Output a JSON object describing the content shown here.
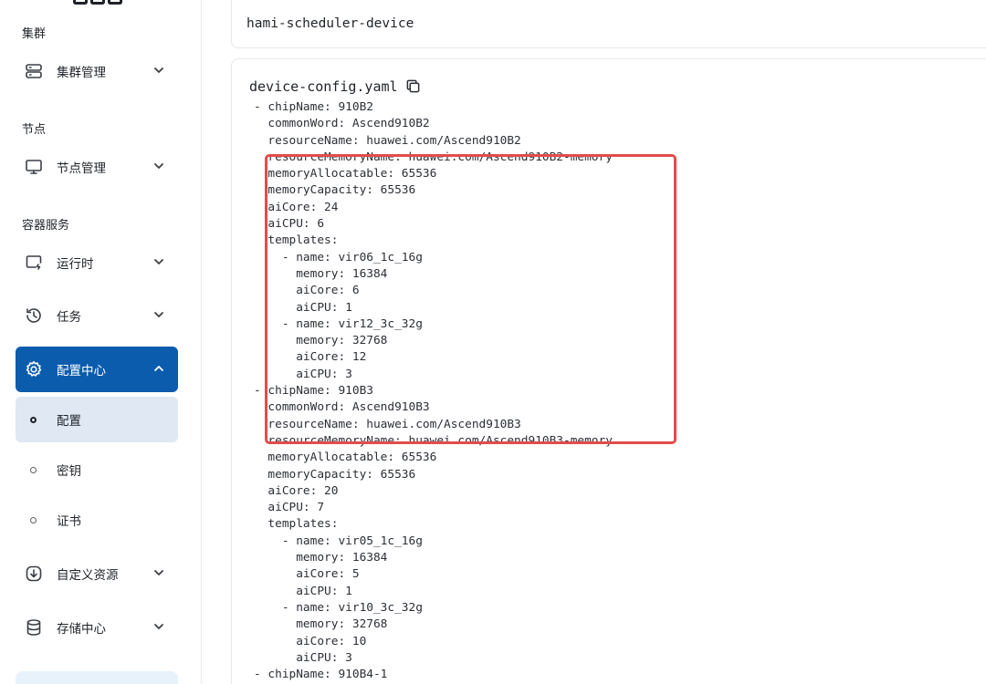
{
  "sidebar": {
    "sections": {
      "cluster": "集群",
      "node": "节点",
      "container": "容器服务"
    },
    "items": {
      "cluster_mgmt": {
        "label": "集群管理",
        "icon": "server-icon"
      },
      "node_mgmt": {
        "label": "节点管理",
        "icon": "monitor-icon"
      },
      "runtime": {
        "label": "运行时",
        "icon": "runtime-icon"
      },
      "tasks": {
        "label": "任务",
        "icon": "history-icon"
      },
      "config_center": {
        "label": "配置中心",
        "icon": "gear-icon",
        "expanded": true
      },
      "config": {
        "label": "配置",
        "selected": true
      },
      "secret": {
        "label": "密钥"
      },
      "certificate": {
        "label": "证书"
      },
      "custom_resource": {
        "label": "自定义资源",
        "icon": "download-circle-icon"
      },
      "storage": {
        "label": "存储中心",
        "icon": "database-icon"
      }
    }
  },
  "main": {
    "config_name": "hami-scheduler-device",
    "file_name": "device-config.yaml",
    "yaml_lines": [
      "- chipName: 910B2",
      "  commonWord: Ascend910B2",
      "  resourceName: huawei.com/Ascend910B2",
      "  resourceMemoryName: huawei.com/Ascend910B2-memory",
      "  memoryAllocatable: 65536",
      "  memoryCapacity: 65536",
      "  aiCore: 24",
      "  aiCPU: 6",
      "  templates:",
      "    - name: vir06_1c_16g",
      "      memory: 16384",
      "      aiCore: 6",
      "      aiCPU: 1",
      "    - name: vir12_3c_32g",
      "      memory: 32768",
      "      aiCore: 12",
      "      aiCPU: 3",
      "- chipName: 910B3",
      "  commonWord: Ascend910B3",
      "  resourceName: huawei.com/Ascend910B3",
      "  resourceMemoryName: huawei.com/Ascend910B3-memory",
      "  memoryAllocatable: 65536",
      "  memoryCapacity: 65536",
      "  aiCore: 20",
      "  aiCPU: 7",
      "  templates:",
      "    - name: vir05_1c_16g",
      "      memory: 16384",
      "      aiCore: 5",
      "      aiCPU: 1",
      "    - name: vir10_3c_32g",
      "      memory: 32768",
      "      aiCore: 10",
      "      aiCPU: 3",
      "- chipName: 910B4-1"
    ],
    "highlight_color": "#e24c4c"
  },
  "colors": {
    "active_nav_bg": "#0c5cae",
    "active_sub_bg": "#dfe8f3"
  }
}
